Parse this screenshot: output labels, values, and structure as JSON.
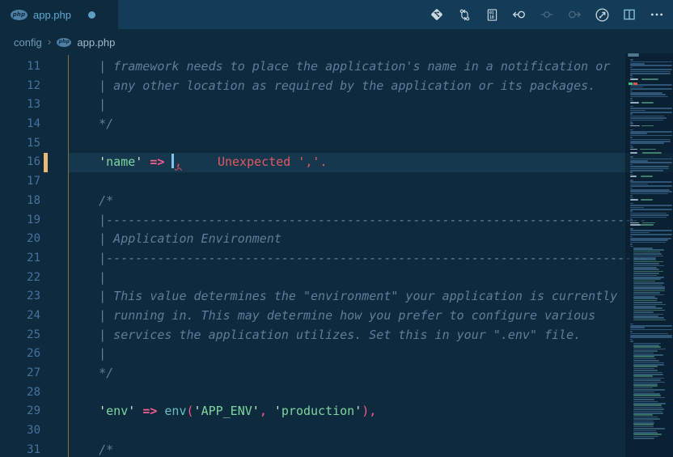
{
  "tab": {
    "label": "app.php",
    "php_badge_text": "php",
    "modified": true
  },
  "breadcrumb": {
    "items": [
      "config",
      "app.php"
    ],
    "separator": "›",
    "php_badge_text": "php"
  },
  "toolbar": {
    "actions": [
      {
        "icon": "git-logo-icon",
        "enabled": true
      },
      {
        "icon": "compare-changes-icon",
        "enabled": true
      },
      {
        "icon": "file-binary-icon",
        "enabled": true
      },
      {
        "icon": "previous-change-icon",
        "enabled": true
      },
      {
        "icon": "commit-previous-icon",
        "enabled": false
      },
      {
        "icon": "commit-next-icon",
        "enabled": false
      },
      {
        "icon": "file-history-icon",
        "enabled": true
      },
      {
        "icon": "split-editor-icon",
        "enabled": true
      },
      {
        "icon": "more-actions-icon",
        "enabled": true
      }
    ]
  },
  "editor": {
    "lines": [
      {
        "n": 11,
        "tokens": [
          {
            "t": "comment",
            "x": "    | framework needs to place the application's name in a notification or"
          }
        ]
      },
      {
        "n": 12,
        "tokens": [
          {
            "t": "comment",
            "x": "    | any other location as required by the application or its packages."
          }
        ]
      },
      {
        "n": 13,
        "tokens": [
          {
            "t": "comment",
            "x": "    |"
          }
        ]
      },
      {
        "n": 14,
        "tokens": [
          {
            "t": "comment",
            "x": "    */"
          }
        ]
      },
      {
        "n": 15,
        "tokens": []
      },
      {
        "n": 16,
        "modified": true,
        "current": true,
        "tokens": [
          {
            "t": "plain",
            "x": "    "
          },
          {
            "t": "quote",
            "x": "'"
          },
          {
            "t": "string",
            "x": "name"
          },
          {
            "t": "quote",
            "x": "'"
          },
          {
            "t": "plain",
            "x": " "
          },
          {
            "t": "op",
            "x": "=>"
          },
          {
            "t": "plain",
            "x": " "
          },
          {
            "t": "cursor"
          },
          {
            "t": "errtok",
            "x": ","
          }
        ],
        "inline_error": "Unexpected ','."
      },
      {
        "n": 17,
        "tokens": []
      },
      {
        "n": 18,
        "tokens": [
          {
            "t": "comment",
            "x": "    /*"
          }
        ]
      },
      {
        "n": 19,
        "tokens": [
          {
            "t": "comment",
            "x": "    |--------------------------------------------------------------------------"
          }
        ]
      },
      {
        "n": 20,
        "tokens": [
          {
            "t": "comment",
            "x": "    | Application Environment"
          }
        ]
      },
      {
        "n": 21,
        "tokens": [
          {
            "t": "comment",
            "x": "    |--------------------------------------------------------------------------"
          }
        ]
      },
      {
        "n": 22,
        "tokens": [
          {
            "t": "comment",
            "x": "    |"
          }
        ]
      },
      {
        "n": 23,
        "tokens": [
          {
            "t": "comment",
            "x": "    | This value determines the \"environment\" your application is currently"
          }
        ]
      },
      {
        "n": 24,
        "tokens": [
          {
            "t": "comment",
            "x": "    | running in. This may determine how you prefer to configure various"
          }
        ]
      },
      {
        "n": 25,
        "tokens": [
          {
            "t": "comment",
            "x": "    | services the application utilizes. Set this in your \".env\" file."
          }
        ]
      },
      {
        "n": 26,
        "tokens": [
          {
            "t": "comment",
            "x": "    |"
          }
        ]
      },
      {
        "n": 27,
        "tokens": [
          {
            "t": "comment",
            "x": "    */"
          }
        ]
      },
      {
        "n": 28,
        "tokens": []
      },
      {
        "n": 29,
        "tokens": [
          {
            "t": "plain",
            "x": "    "
          },
          {
            "t": "quote",
            "x": "'"
          },
          {
            "t": "string",
            "x": "env"
          },
          {
            "t": "quote",
            "x": "'"
          },
          {
            "t": "plain",
            "x": " "
          },
          {
            "t": "op",
            "x": "=>"
          },
          {
            "t": "plain",
            "x": " "
          },
          {
            "t": "func",
            "x": "env"
          },
          {
            "t": "punct",
            "x": "("
          },
          {
            "t": "quote",
            "x": "'"
          },
          {
            "t": "string",
            "x": "APP_ENV"
          },
          {
            "t": "quote",
            "x": "'"
          },
          {
            "t": "punct",
            "x": ","
          },
          {
            "t": "plain",
            "x": " "
          },
          {
            "t": "quote",
            "x": "'"
          },
          {
            "t": "string",
            "x": "production"
          },
          {
            "t": "quote",
            "x": "'"
          },
          {
            "t": "punct",
            "x": ")"
          },
          {
            "t": "punct",
            "x": ","
          }
        ]
      },
      {
        "n": 30,
        "tokens": []
      },
      {
        "n": 31,
        "tokens": [
          {
            "t": "comment",
            "x": "    /*"
          }
        ]
      }
    ]
  },
  "minimap": {
    "row_height": 2.4,
    "sections": [
      {
        "kind": "header",
        "rows": 2
      },
      {
        "kind": "gap",
        "rows": 1
      },
      {
        "kind": "comment",
        "rows": 10
      },
      {
        "kind": "entry",
        "rows": 1
      },
      {
        "kind": "gap",
        "rows": 1
      },
      {
        "kind": "comment",
        "rows": 10
      },
      {
        "kind": "entry",
        "rows": 1
      },
      {
        "kind": "gap",
        "rows": 1
      },
      {
        "kind": "comment",
        "rows": 10
      },
      {
        "kind": "entry",
        "rows": 1
      },
      {
        "kind": "gap",
        "rows": 1
      },
      {
        "kind": "comment",
        "rows": 10
      },
      {
        "kind": "entry",
        "rows": 1
      },
      {
        "kind": "gap",
        "rows": 1
      },
      {
        "kind": "entry",
        "rows": 1
      },
      {
        "kind": "gap",
        "rows": 1
      },
      {
        "kind": "comment",
        "rows": 10
      },
      {
        "kind": "entry",
        "rows": 1
      },
      {
        "kind": "gap",
        "rows": 1
      },
      {
        "kind": "comment",
        "rows": 10
      },
      {
        "kind": "entry",
        "rows": 1
      },
      {
        "kind": "gap",
        "rows": 1
      },
      {
        "kind": "comment",
        "rows": 10
      },
      {
        "kind": "entry",
        "rows": 2
      },
      {
        "kind": "gap",
        "rows": 1
      },
      {
        "kind": "comment",
        "rows": 10
      },
      {
        "kind": "array",
        "rows": 38
      },
      {
        "kind": "gap",
        "rows": 1
      },
      {
        "kind": "comment",
        "rows": 10
      },
      {
        "kind": "array",
        "rows": 50
      }
    ],
    "decorations": [
      {
        "line": 16,
        "marks": [
          "modified",
          "error"
        ]
      }
    ]
  },
  "colors": {
    "bg": "#0d2a3e",
    "bg_tabstrip": "#133c58",
    "tab_label": "#5fa9d2",
    "dot": "#5d9ec6",
    "php_badge": "#4e80a6",
    "crumb": "#6f9cb6",
    "crumb2": "#a3bac7",
    "crumb_sep": "#557d95",
    "icon": "#ccd9e0",
    "icon_dim": "#47687e",
    "icon_split": "#8cc1da",
    "linenum": "#47739f",
    "comment": "#5f7e97",
    "quote": "#cfe5d8",
    "string": "#7dd6a0",
    "op": "#f75c8c",
    "func": "#67c1bd",
    "errtok": "#e04c5a",
    "error": "#e25862",
    "cursor": "#7ec3ea",
    "line_hl": "#16384e",
    "mod": "#ecb878",
    "guide": "#82703f",
    "minimap_bg": "rgba(8,26,40,0.55)",
    "mm_comment": "#42719b",
    "mm_entry_label": "#b9d2e2",
    "mm_entry_val": "#5aa584",
    "mm_array": "#4d7ea3",
    "mm_header": "#7aa6c4",
    "mm_modified": "#3fbd7e",
    "mm_error": "#e14f4f"
  }
}
